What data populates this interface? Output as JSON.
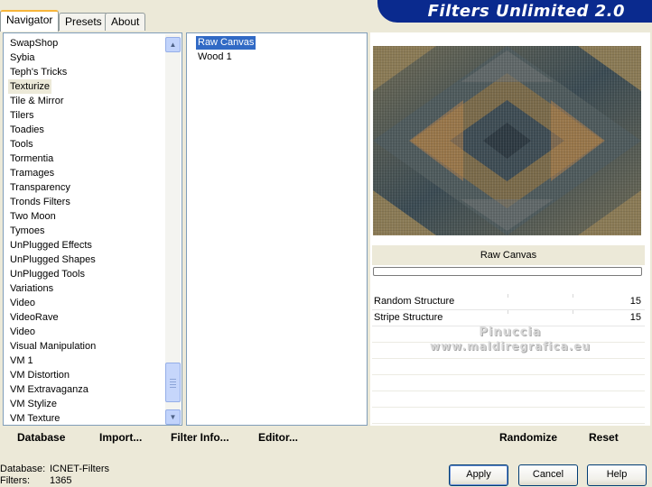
{
  "tabs": [
    {
      "label": "Navigator",
      "active": true
    },
    {
      "label": "Presets",
      "active": false
    },
    {
      "label": "About",
      "active": false
    }
  ],
  "app_title": "Filters Unlimited 2.0",
  "categories": [
    "SwapShop",
    "Sybia",
    "Teph's Tricks",
    "Texturize",
    "Tile & Mirror",
    "Tilers",
    "Toadies",
    "Tools",
    "Tormentia",
    "Tramages",
    "Transparency",
    "Tronds Filters",
    "Two Moon",
    "Tymoes",
    "UnPlugged Effects",
    "UnPlugged Shapes",
    "UnPlugged Tools",
    "Variations",
    "Video",
    "VideoRave",
    "Video",
    "Visual Manipulation",
    "VM 1",
    "VM Distortion",
    "VM Extravaganza",
    "VM Stylize",
    "VM Texture"
  ],
  "selected_category": "Texturize",
  "filters": [
    "Raw Canvas",
    "Wood 1"
  ],
  "selected_filter": "Raw Canvas",
  "preview": {
    "filter_name": "Raw Canvas",
    "params": [
      {
        "label": "Random Structure",
        "value": "15"
      },
      {
        "label": "Stripe Structure",
        "value": "15"
      }
    ],
    "watermark_line1": "Pinuccia",
    "watermark_line2": "www.maldiregrafica.eu"
  },
  "links": {
    "database": "Database",
    "import": "Import...",
    "filter_info": "Filter Info...",
    "editor": "Editor...",
    "randomize": "Randomize",
    "reset": "Reset"
  },
  "status": {
    "database_label": "Database:",
    "database_value": "ICNET-Filters",
    "filters_label": "Filters:",
    "filters_value": "1365"
  },
  "buttons": {
    "apply": "Apply",
    "cancel": "Cancel",
    "help": "Help"
  },
  "icons": {
    "scroll_up": "chevron-up-icon",
    "scroll_down": "chevron-down-icon"
  },
  "colors": {
    "banner": "#0a2a8e",
    "selection": "#316ac5",
    "window": "#ece9d8"
  }
}
